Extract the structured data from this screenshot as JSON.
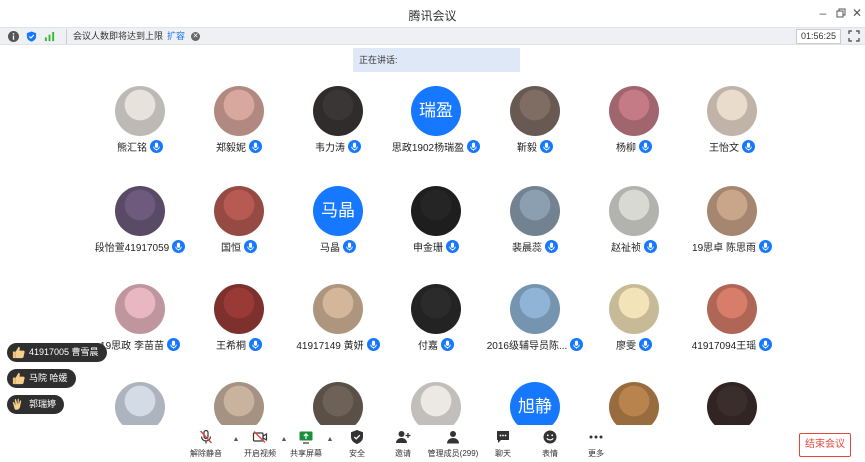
{
  "window": {
    "title": "腾讯会议"
  },
  "notice": {
    "text": "会议人数即将达到上限",
    "action": "扩容"
  },
  "timer": "01:56:25",
  "speaking_label": "正在讲话:",
  "participants": [
    {
      "name": "熊汇铭",
      "avatar": "photo",
      "color": "#e7e2dc"
    },
    {
      "name": "郑毅妮",
      "avatar": "photo",
      "color": "#d8a79d"
    },
    {
      "name": "韦力涛",
      "avatar": "photo",
      "color": "#3b3636"
    },
    {
      "name": "思政1902杨瑞盈",
      "avatar": "text",
      "text": "瑞盈"
    },
    {
      "name": "靳毅",
      "avatar": "photo",
      "color": "#7f6d64"
    },
    {
      "name": "杨柳",
      "avatar": "photo",
      "color": "#c47b86"
    },
    {
      "name": "王怡文",
      "avatar": "photo",
      "color": "#eadccd"
    },
    {
      "name": "段怡萱41917059",
      "avatar": "photo",
      "color": "#6d5a7d"
    },
    {
      "name": "国恒",
      "avatar": "photo",
      "color": "#b65a52"
    },
    {
      "name": "马晶",
      "avatar": "text",
      "text": "马晶"
    },
    {
      "name": "申金珊",
      "avatar": "photo",
      "color": "#252525"
    },
    {
      "name": "裴晨蕊",
      "avatar": "photo",
      "color": "#8b9fb1"
    },
    {
      "name": "赵祉祯",
      "avatar": "photo",
      "color": "#d9d9d4"
    },
    {
      "name": "19思卓 陈思雨",
      "avatar": "photo",
      "color": "#c9a58a"
    },
    {
      "name": "19思政 李苗苗",
      "avatar": "photo",
      "color": "#e9b7c0"
    },
    {
      "name": "王希桐",
      "avatar": "photo",
      "color": "#9a3a36"
    },
    {
      "name": "41917149 黄妍",
      "avatar": "photo",
      "color": "#d4b69a"
    },
    {
      "name": "付嘉",
      "avatar": "photo",
      "color": "#2b2b2b"
    },
    {
      "name": "2016级辅导员陈...",
      "avatar": "photo",
      "color": "#8fb4d6"
    },
    {
      "name": "廖雯",
      "avatar": "photo",
      "color": "#f3e3b8"
    },
    {
      "name": "41917094王瑶",
      "avatar": "photo",
      "color": "#d77d6a"
    },
    {
      "name": "",
      "avatar": "photo",
      "color": "#d3dbe6"
    },
    {
      "name": "",
      "avatar": "photo",
      "color": "#c9b29e"
    },
    {
      "name": "",
      "avatar": "photo",
      "color": "#6e6258"
    },
    {
      "name": "",
      "avatar": "photo",
      "color": "#ece8e4"
    },
    {
      "name": "",
      "avatar": "text",
      "text": "旭静"
    },
    {
      "name": "",
      "avatar": "photo",
      "color": "#b9834d"
    },
    {
      "name": "",
      "avatar": "photo",
      "color": "#3a2d2a"
    }
  ],
  "reactions": [
    {
      "label": "41917005 曹雪晨",
      "icon": "thumbs-up"
    },
    {
      "label": "马院 哈媛",
      "icon": "thumbs-up"
    },
    {
      "label": "郭瑞婷",
      "icon": "clap"
    }
  ],
  "toolbar": {
    "unmute": "解除静音",
    "video": "开启视频",
    "share": "共享屏幕",
    "security": "安全",
    "invite": "邀请",
    "members": "管理成员(299)",
    "chat": "聊天",
    "emoji": "表情",
    "more": "更多",
    "end": "结束会议"
  },
  "colors": {
    "accent": "#1677ff",
    "danger": "#e0483e",
    "speaking_bg": "#dfe8f6"
  }
}
